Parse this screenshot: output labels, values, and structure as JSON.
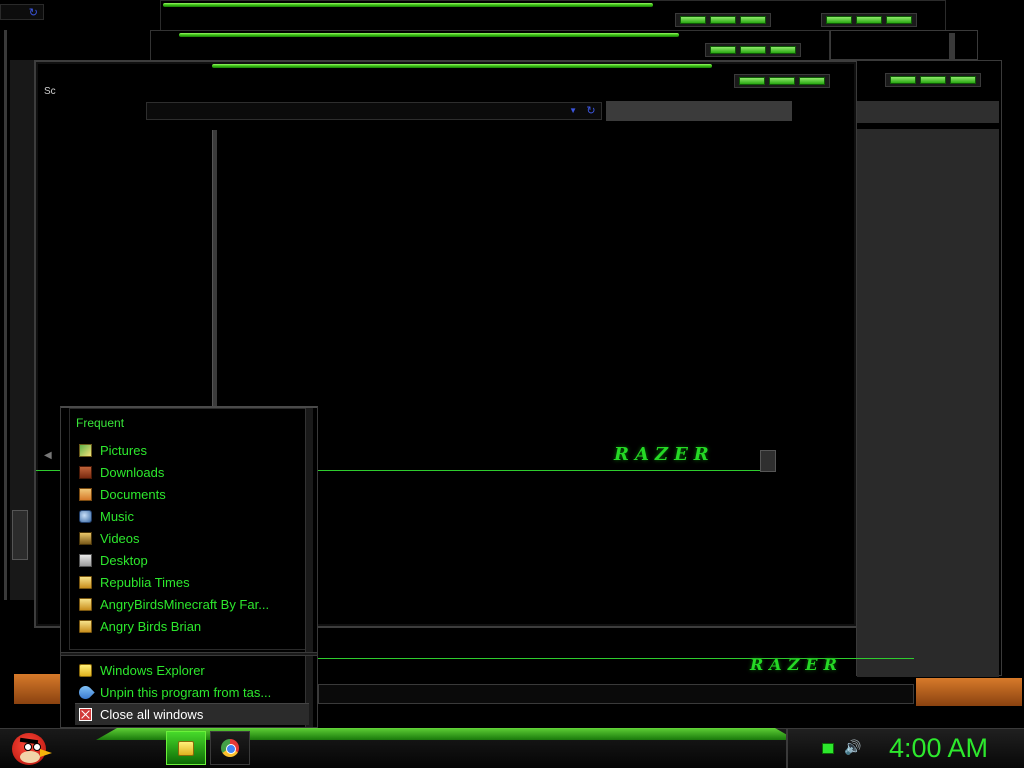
{
  "background_windows": {
    "brand_logo_text": "RAZER",
    "partial_label": "Sc"
  },
  "jumplist": {
    "section_title": "Frequent",
    "items": [
      {
        "label": "Pictures",
        "icon": "pictures-icon"
      },
      {
        "label": "Downloads",
        "icon": "downloads-icon"
      },
      {
        "label": "Documents",
        "icon": "documents-icon"
      },
      {
        "label": "Music",
        "icon": "music-icon"
      },
      {
        "label": "Videos",
        "icon": "videos-icon"
      },
      {
        "label": "Desktop",
        "icon": "desktop-icon"
      },
      {
        "label": "Republia Times",
        "icon": "folder-icon"
      },
      {
        "label": "AngryBirdsMinecraft By Far...",
        "icon": "folder-icon"
      },
      {
        "label": "Angry Birds Brian",
        "icon": "folder-icon"
      }
    ],
    "tasks": [
      {
        "label": "Windows Explorer",
        "icon": "explorer-icon"
      },
      {
        "label": "Unpin this program from tas...",
        "icon": "unpin-icon"
      },
      {
        "label": "Close all windows",
        "icon": "close-windows-icon"
      }
    ]
  },
  "taskbar": {
    "start_icon": "angry-bird-icon",
    "pinned": [
      {
        "name": "Windows Explorer",
        "icon": "explorer-icon",
        "active": true
      },
      {
        "name": "Google Chrome",
        "icon": "chrome-icon",
        "active": false
      }
    ]
  },
  "tray": {
    "clock": "4:00 AM",
    "icons": [
      "network-icon",
      "volume-icon"
    ]
  },
  "colors": {
    "accent_green": "#2de82d",
    "bar_green": "#3fc416",
    "background": "#000000",
    "orange": "#d77a2a"
  }
}
